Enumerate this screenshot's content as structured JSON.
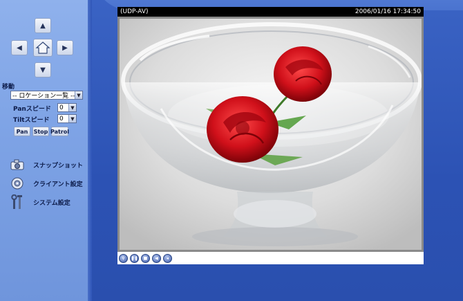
{
  "ptz": {
    "up": "▲",
    "left": "◀",
    "right": "▶",
    "down": "▼",
    "home": "⌂"
  },
  "move": {
    "label": "移動",
    "location_select": "-- ロケーション一覧 --"
  },
  "pan_speed": {
    "label": "Panスピード",
    "value": "0"
  },
  "tilt_speed": {
    "label": "Tiltスピード",
    "value": "0"
  },
  "buttons": {
    "pan": "Pan",
    "stop": "Stop",
    "patrol": "Patrol"
  },
  "menu": [
    {
      "label": "スナップショット",
      "icon": "camera-icon"
    },
    {
      "label": "クライアント設定",
      "icon": "disc-icon"
    },
    {
      "label": "システム設定",
      "icon": "tools-icon"
    }
  ],
  "viewer": {
    "title": "(UDP-AV)",
    "timestamp": "2006/01/16 17:34:50"
  },
  "controls": [
    {
      "icon": "zoom-icon"
    },
    {
      "icon": "pause-icon"
    },
    {
      "icon": "stop-icon"
    },
    {
      "icon": "speaker-icon"
    },
    {
      "icon": "volume-icon"
    }
  ],
  "colors": {
    "background": "#2f55b8",
    "panel": "#7fa4e6",
    "title_bar": "#000000",
    "rose": "#d0101a"
  }
}
